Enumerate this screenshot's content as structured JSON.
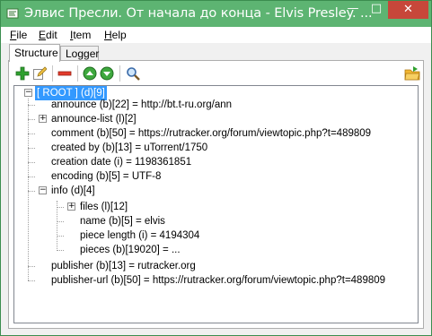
{
  "window": {
    "title": "Элвис Пресли. От начала до конца - Elvis Presley. ...",
    "controls": {
      "minimize": "—",
      "maximize": "□",
      "close": "✕"
    }
  },
  "menu": {
    "file": {
      "mnemonic": "F",
      "rest": "ile"
    },
    "edit": {
      "mnemonic": "E",
      "rest": "dit"
    },
    "item": {
      "mnemonic": "I",
      "rest": "tem"
    },
    "help": {
      "mnemonic": "H",
      "rest": "elp"
    }
  },
  "tabs": {
    "structure": "Structure",
    "logger": "Logger"
  },
  "toolbar": {
    "icons": [
      "add-icon",
      "edit-icon",
      "remove-icon",
      "move-up-icon",
      "move-down-icon",
      "search-icon",
      "open-folder-icon"
    ],
    "colors": {
      "add": "#2fa02f",
      "remove": "#e23b2b",
      "move": "#3ea83e",
      "folder": "#f2b631"
    }
  },
  "tree": {
    "root": "[ ROOT ] (d)[9]",
    "nodes": {
      "announce": "announce (b)[22] = http://bt.t-ru.org/ann",
      "announce_list": "announce-list (l)[2]",
      "comment": "comment (b)[50] = https://rutracker.org/forum/viewtopic.php?t=489809",
      "created_by": "created by (b)[13] = uTorrent/1750",
      "creation_date": "creation date (i) = 1198361851",
      "encoding": "encoding (b)[5] = UTF-8",
      "info": "info (d)[4]",
      "files": "files (l)[12]",
      "name": "name (b)[5] = elvis",
      "piece_length": "piece length (i) = 4194304",
      "pieces": "pieces (b)[19020] = ...",
      "publisher": "publisher (b)[13] = rutracker.org",
      "publisher_url": "publisher-url (b)[50] = https://rutracker.org/forum/viewtopic.php?t=489809"
    },
    "expanders": {
      "collapsed": "+",
      "expanded": "−"
    },
    "selection_color": "#3399ff"
  }
}
